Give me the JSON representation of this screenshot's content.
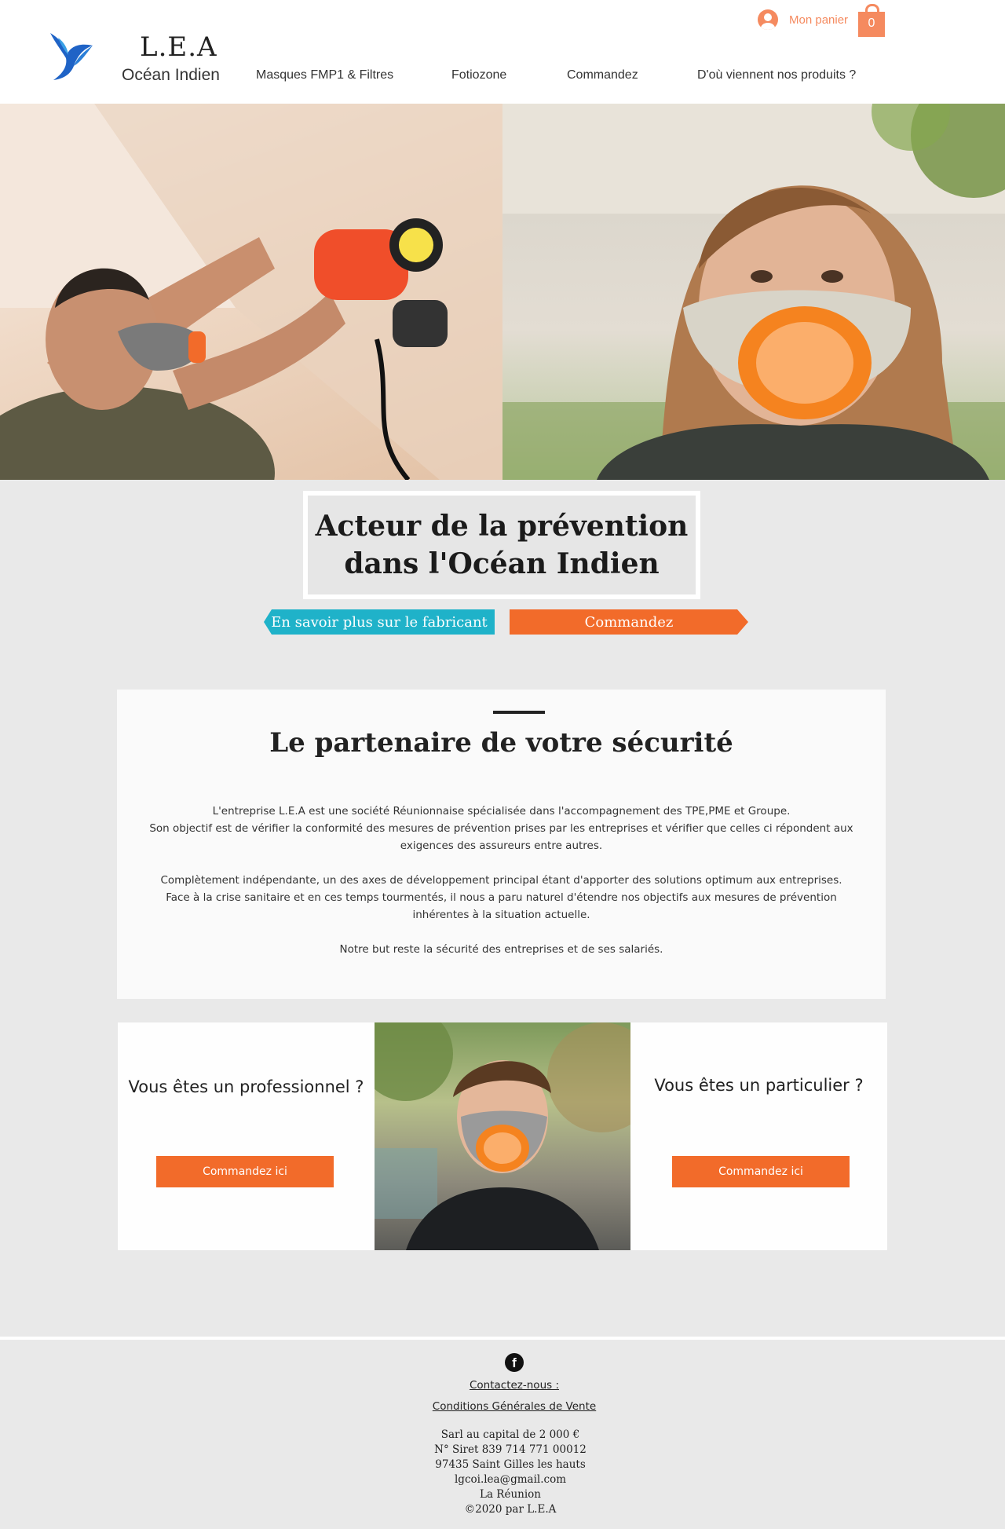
{
  "header": {
    "brand_title": "L.E.A",
    "brand_subtitle": "Océan Indien",
    "nav": [
      "Masques FMP1 & Filtres",
      "Fotiozone",
      "Commandez",
      "D'où viennent nos produits ?"
    ],
    "login_label": "Mon panier",
    "cart_count": "0",
    "accent_color": "#f58a5f"
  },
  "hero": {
    "headline_line1": "Acteur de la prévention",
    "headline_line2": "dans l'Océan Indien",
    "fabricant_button": "En savoir plus sur le fabricant",
    "order_button": "Commandez",
    "fabricant_color": "#1fb2c9",
    "order_color": "#f26b2a"
  },
  "partner": {
    "title": "Le partenaire de votre sécurité",
    "paragraphs": [
      "L'entreprise L.E.A est une société Réunionnaise spécialisée dans l'accompagnement des TPE,PME et Groupe.",
      "Son objectif est de vérifier la conformité des mesures de prévention prises par les entreprises et vérifier que celles ci répondent aux",
      "exigences des assureurs entre autres.",
      "Complètement indépendante, un des axes de développement principal étant d'apporter des solutions optimum aux entreprises.",
      "Face à la crise sanitaire et en ces temps tourmentés, il nous a paru naturel d'étendre nos objectifs aux mesures de prévention",
      "inhérentes à la situation actuelle.",
      "Notre but reste la sécurité des entreprises et de ses salariés."
    ]
  },
  "audience": {
    "pro_question": "Vous êtes un professionnel ?",
    "pro_button": "Commandez ici",
    "part_question": "Vous êtes un particulier ?",
    "part_button": "Commandez ici"
  },
  "footer": {
    "facebook_icon": "f",
    "contact_link": "Contactez-nous :",
    "cgv_link": "Conditions Générales de Vente",
    "lines": [
      "Sarl au capital de 2 000 €",
      "N° Siret 839 714 771 00012",
      "97435 Saint Gilles les hauts",
      "lgcoi.lea@gmail.com",
      "La Réunion",
      "©2020 par L.E.A"
    ]
  }
}
